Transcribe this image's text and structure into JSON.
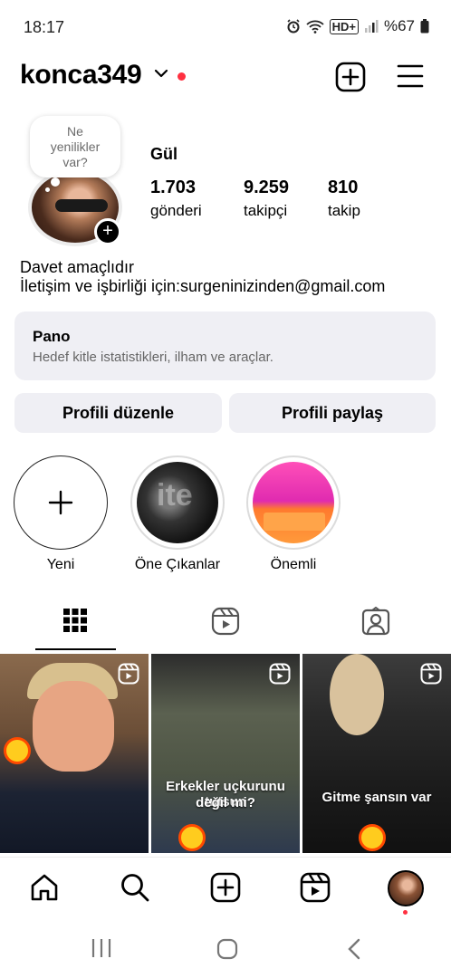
{
  "status_bar": {
    "time": "18:17",
    "battery": "%67",
    "network": "HD+"
  },
  "header": {
    "username": "konca349"
  },
  "profile": {
    "note_lines": [
      "Ne",
      "yenilikler",
      "var?"
    ],
    "full_name": "Gül",
    "stats": [
      {
        "value": "1.703",
        "label": "gönderi"
      },
      {
        "value": "9.259",
        "label": "takipçi"
      },
      {
        "value": "810",
        "label": "takip"
      }
    ],
    "bio_line1": "Davet amaçlıdır",
    "bio_line2": "İletişim ve işbirliği için:surgeninizinden@gmail.com"
  },
  "pano": {
    "title": "Pano",
    "subtitle": "Hedef kitle istatistikleri, ilham ve araçlar."
  },
  "buttons": {
    "edit": "Profili düzenle",
    "share": "Profili paylaş"
  },
  "highlights": [
    {
      "label": "Yeni"
    },
    {
      "label": "Öne Çıkanlar",
      "watermark": "ite"
    },
    {
      "label": "Önemli"
    }
  ],
  "grid": [
    {
      "caption": ""
    },
    {
      "caption_line1": "Erkekler uçkurunu tutsun",
      "caption_line2": "değil mi?"
    },
    {
      "caption": "Gitme şansın var"
    }
  ],
  "colors": {
    "accent_red": "#ff3040",
    "button_bg": "#efeff4"
  }
}
